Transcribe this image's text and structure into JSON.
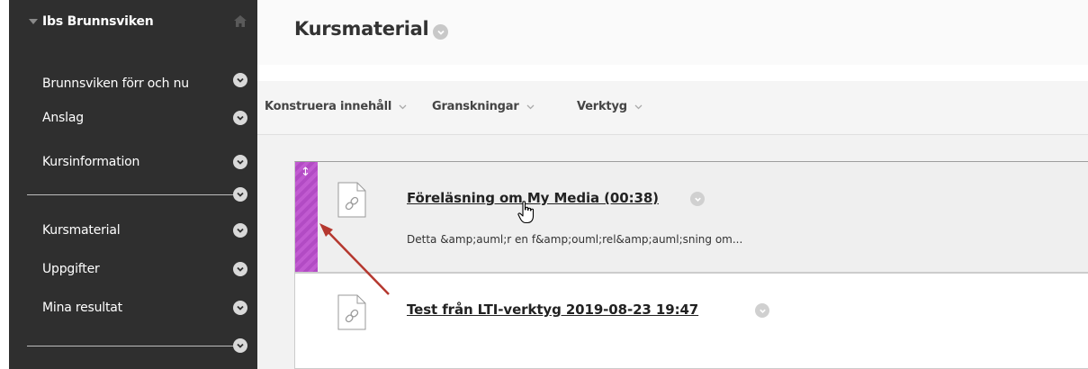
{
  "sidebar": {
    "course_name": "Ibs Brunnsviken",
    "items": [
      {
        "label": "Brunnsviken förr och nu"
      },
      {
        "label": "Anslag"
      },
      {
        "label": "Kursinformation"
      },
      {
        "label": "Kursmaterial"
      },
      {
        "label": "Uppgifter"
      },
      {
        "label": "Mina resultat"
      }
    ]
  },
  "page": {
    "title": "Kursmaterial"
  },
  "toolbar": {
    "build_content": "Konstruera innehåll",
    "assessments": "Granskningar",
    "tools": "Verktyg"
  },
  "content_items": [
    {
      "title": "Föreläsning om My Media (00:38)",
      "description": "Detta &amp;auml;r en f&amp;ouml;rel&amp;auml;sning om..."
    },
    {
      "title": "Test från LTI-verktyg 2019-08-23 19:47"
    }
  ],
  "colors": {
    "sidebar_bg": "#2f2f2f",
    "drag_handle": "#c15bd1",
    "annotation_arrow": "#b5382f"
  },
  "icons": [
    "home-icon",
    "chevron-down-icon",
    "file-link-icon",
    "drag-handle-icon",
    "hand-cursor-icon"
  ]
}
